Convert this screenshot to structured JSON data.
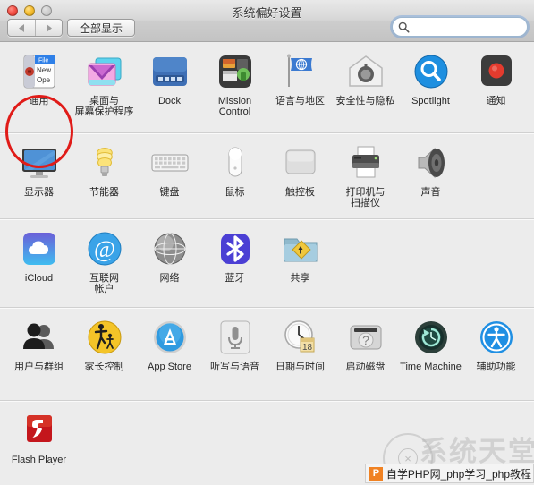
{
  "window": {
    "title": "系统偏好设置",
    "traffic_lights": [
      {
        "name": "close",
        "color": "#f5554b"
      },
      {
        "name": "minimize",
        "color": "#f7c036"
      },
      {
        "name": "zoom",
        "color": "#cfcfcf"
      }
    ]
  },
  "toolbar": {
    "back_label": "◀",
    "forward_label": "▶",
    "show_all_label": "全部显示",
    "search": {
      "icon": "search-icon",
      "value": "",
      "placeholder": ""
    }
  },
  "highlight": {
    "target": "显示器",
    "color": "#e01b18",
    "shape": "ellipse"
  },
  "watermarks": {
    "circle_label": "×",
    "big_text": "系统天堂",
    "bottom_bar": {
      "badge": "P",
      "text": "自学PHP网_php学习_php教程"
    }
  },
  "rows": [
    {
      "name": "personal",
      "items": [
        {
          "label": "通用",
          "label2": "",
          "icon": "general-icon"
        },
        {
          "label": "桌面与",
          "label2": "屏幕保护程序",
          "icon": "desktop-screensaver-icon"
        },
        {
          "label": "Dock",
          "label2": "",
          "icon": "dock-icon"
        },
        {
          "label": "Mission",
          "label2": "Control",
          "icon": "mission-control-icon"
        },
        {
          "label": "语言与地区",
          "label2": "",
          "icon": "language-region-icon"
        },
        {
          "label": "安全性与隐私",
          "label2": "",
          "icon": "security-privacy-icon"
        },
        {
          "label": "Spotlight",
          "label2": "",
          "icon": "spotlight-icon"
        },
        {
          "label": "通知",
          "label2": "",
          "icon": "notifications-icon"
        }
      ]
    },
    {
      "name": "hardware",
      "items": [
        {
          "label": "显示器",
          "label2": "",
          "icon": "displays-icon"
        },
        {
          "label": "节能器",
          "label2": "",
          "icon": "energy-saver-icon"
        },
        {
          "label": "键盘",
          "label2": "",
          "icon": "keyboard-icon"
        },
        {
          "label": "鼠标",
          "label2": "",
          "icon": "mouse-icon"
        },
        {
          "label": "触控板",
          "label2": "",
          "icon": "trackpad-icon"
        },
        {
          "label": "打印机与",
          "label2": "扫描仪",
          "icon": "printers-scanners-icon"
        },
        {
          "label": "声音",
          "label2": "",
          "icon": "sound-icon"
        }
      ]
    },
    {
      "name": "internet-wireless",
      "items": [
        {
          "label": "iCloud",
          "label2": "",
          "icon": "icloud-icon"
        },
        {
          "label": "互联网",
          "label2": "帐户",
          "icon": "internet-accounts-icon"
        },
        {
          "label": "网络",
          "label2": "",
          "icon": "network-icon"
        },
        {
          "label": "蓝牙",
          "label2": "",
          "icon": "bluetooth-icon"
        },
        {
          "label": "共享",
          "label2": "",
          "icon": "sharing-icon"
        }
      ]
    },
    {
      "name": "system",
      "items": [
        {
          "label": "用户与群组",
          "label2": "",
          "icon": "users-groups-icon"
        },
        {
          "label": "家长控制",
          "label2": "",
          "icon": "parental-controls-icon"
        },
        {
          "label": "App Store",
          "label2": "",
          "icon": "app-store-icon"
        },
        {
          "label": "听写与语音",
          "label2": "",
          "icon": "dictation-speech-icon"
        },
        {
          "label": "日期与时间",
          "label2": "",
          "icon": "date-time-icon"
        },
        {
          "label": "启动磁盘",
          "label2": "",
          "icon": "startup-disk-icon"
        },
        {
          "label": "Time Machine",
          "label2": "",
          "icon": "time-machine-icon"
        },
        {
          "label": "辅助功能",
          "label2": "",
          "icon": "accessibility-icon"
        }
      ]
    },
    {
      "name": "other",
      "items": [
        {
          "label": "Flash Player",
          "label2": "",
          "icon": "flash-player-icon"
        }
      ]
    }
  ]
}
